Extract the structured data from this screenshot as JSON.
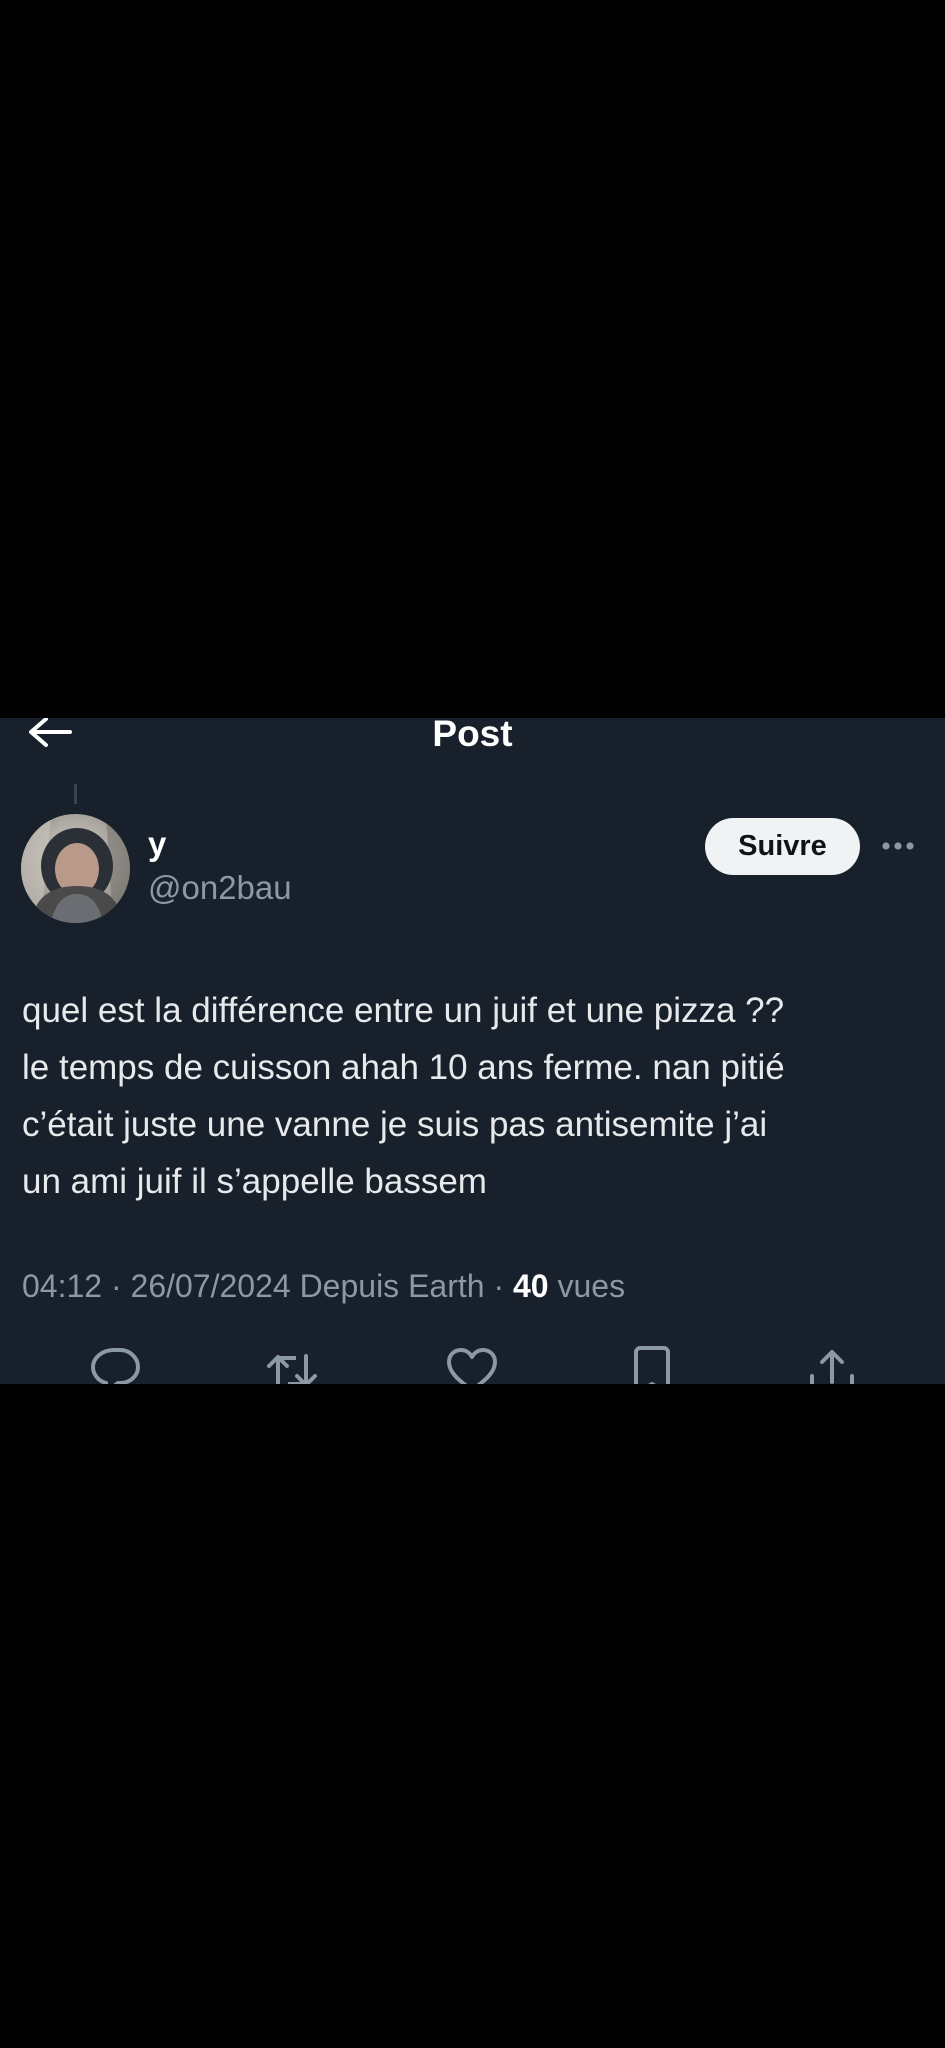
{
  "header": {
    "title": "Post",
    "back_icon": "arrow-left-icon"
  },
  "author": {
    "display_name": "y",
    "handle": "@on2bau",
    "avatar": "blurred-profile-photo"
  },
  "follow_label": "Suivre",
  "more_icon": "more-horizontal-icon",
  "tweet": {
    "text": "quel est la différence entre un juif et une pizza ??\nle temps de cuisson ahah 10 ans ferme. nan pitié\nc’était juste une vanne je suis pas antisemite j’ai\nun ami juif il s’appelle bassem"
  },
  "meta": {
    "time": "04:12",
    "date": "26/07/2024",
    "source": "Depuis Earth",
    "separator": " · ",
    "views_count": "40",
    "views_label": "vues"
  },
  "actions": [
    {
      "name": "reply",
      "icon": "reply-icon"
    },
    {
      "name": "retweet",
      "icon": "retweet-icon"
    },
    {
      "name": "like",
      "icon": "heart-icon"
    },
    {
      "name": "bookmark",
      "icon": "bookmark-icon"
    },
    {
      "name": "share",
      "icon": "share-icon"
    }
  ],
  "colors": {
    "background": "#17202b",
    "outer": "#000000",
    "text_primary": "#e7e9ea",
    "text_secondary": "#8b98a5",
    "button_bg": "#eff3f4"
  }
}
